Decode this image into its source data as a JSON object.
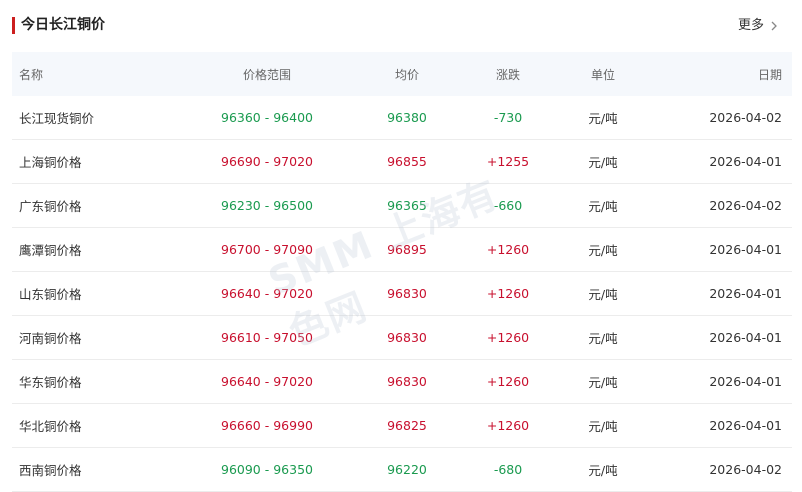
{
  "header": {
    "title": "今日长江铜价",
    "more_label": "更多"
  },
  "table": {
    "columns": [
      "名称",
      "价格范围",
      "均价",
      "涨跌",
      "单位",
      "日期"
    ],
    "rows": [
      {
        "name": "长江现货铜价",
        "range": "96360 - 96400",
        "avg": "96380",
        "change": "-730",
        "unit": "元/吨",
        "date": "2026-04-02",
        "trend": "down"
      },
      {
        "name": "上海铜价格",
        "range": "96690 - 97020",
        "avg": "96855",
        "change": "+1255",
        "unit": "元/吨",
        "date": "2026-04-01",
        "trend": "up"
      },
      {
        "name": "广东铜价格",
        "range": "96230 - 96500",
        "avg": "96365",
        "change": "-660",
        "unit": "元/吨",
        "date": "2026-04-02",
        "trend": "down"
      },
      {
        "name": "鹰潭铜价格",
        "range": "96700 - 97090",
        "avg": "96895",
        "change": "+1260",
        "unit": "元/吨",
        "date": "2026-04-01",
        "trend": "up"
      },
      {
        "name": "山东铜价格",
        "range": "96640 - 97020",
        "avg": "96830",
        "change": "+1260",
        "unit": "元/吨",
        "date": "2026-04-01",
        "trend": "up"
      },
      {
        "name": "河南铜价格",
        "range": "96610 - 97050",
        "avg": "96830",
        "change": "+1260",
        "unit": "元/吨",
        "date": "2026-04-01",
        "trend": "up"
      },
      {
        "name": "华东铜价格",
        "range": "96640 - 97020",
        "avg": "96830",
        "change": "+1260",
        "unit": "元/吨",
        "date": "2026-04-01",
        "trend": "up"
      },
      {
        "name": "华北铜价格",
        "range": "96660 - 96990",
        "avg": "96825",
        "change": "+1260",
        "unit": "元/吨",
        "date": "2026-04-01",
        "trend": "up"
      },
      {
        "name": "西南铜价格",
        "range": "96090 - 96350",
        "avg": "96220",
        "change": "-680",
        "unit": "元/吨",
        "date": "2026-04-02",
        "trend": "down"
      }
    ]
  },
  "watermark": {
    "text": "SMM 上海有色网"
  },
  "colors": {
    "accent": "#cc1f1f",
    "up": "#c8102e",
    "down": "#1a9a4f",
    "header_bg": "#f5f8fc"
  }
}
